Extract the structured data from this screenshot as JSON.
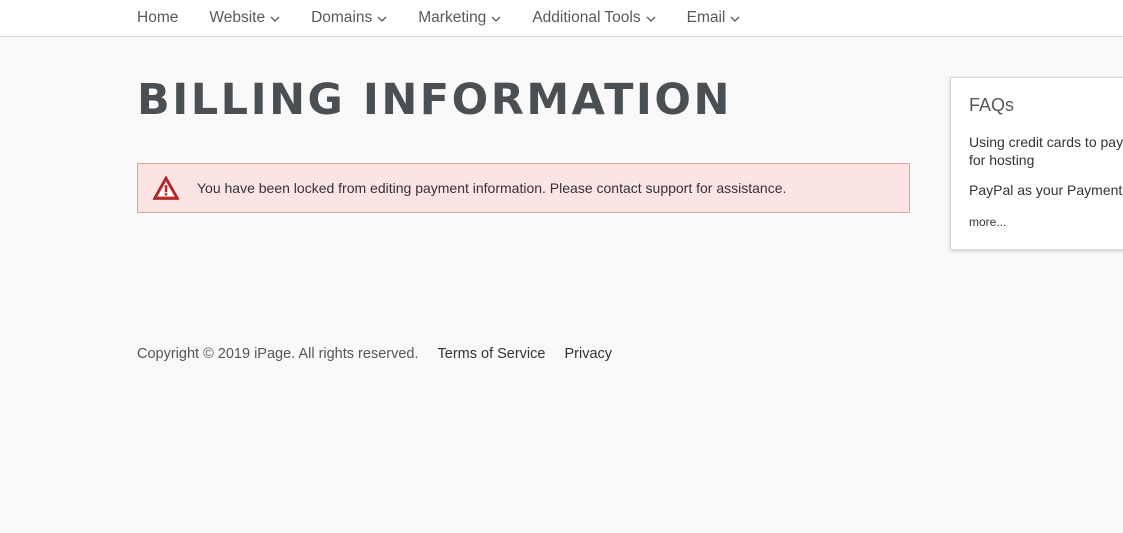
{
  "nav": {
    "items": [
      {
        "label": "Home",
        "has_dropdown": false
      },
      {
        "label": "Website",
        "has_dropdown": true
      },
      {
        "label": "Domains",
        "has_dropdown": true
      },
      {
        "label": "Marketing",
        "has_dropdown": true
      },
      {
        "label": "Additional Tools",
        "has_dropdown": true
      },
      {
        "label": "Email",
        "has_dropdown": true
      }
    ]
  },
  "page": {
    "title": "BILLING INFORMATION"
  },
  "alert": {
    "icon": "warning-triangle-icon",
    "message": "You have been locked from editing payment information. Please contact support for assistance.",
    "color_bg": "#fce4e4",
    "color_border": "#e3a2a2",
    "icon_color": "#c62828"
  },
  "faq": {
    "title": "FAQs",
    "items": [
      "Using credit cards to pay for hosting",
      "PayPal as your Payment Method"
    ],
    "more_label": "more..."
  },
  "footer": {
    "copyright": "Copyright © 2019  iPage. All rights reserved.",
    "terms_label": "Terms of Service",
    "privacy_label": "Privacy"
  }
}
